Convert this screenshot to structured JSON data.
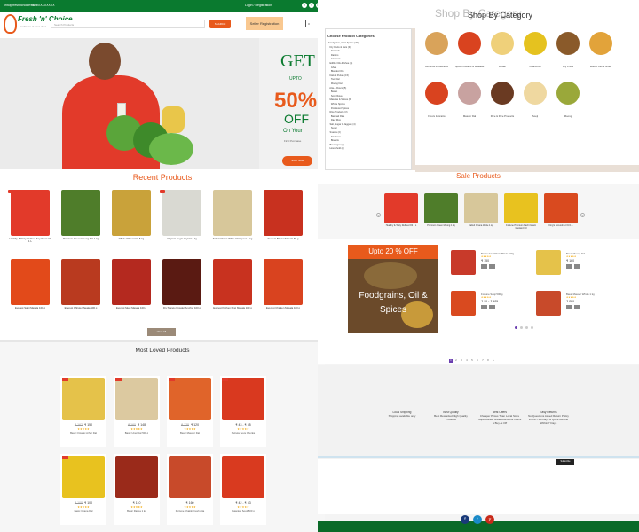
{
  "topbar": {
    "email": "info@freshnchoice.com",
    "phone": "+91 9XXXXXXXX",
    "social": [
      "f",
      "t",
      "in"
    ]
  },
  "header": {
    "brand": "Fresh 'n' Choice",
    "tagline": "freshness at your door",
    "search_placeholder": "Search Products",
    "search_button": "SEARCH",
    "login": "Login / Registration",
    "seller": "Seller Registration",
    "cart_count": "0"
  },
  "hero": {
    "get": "GET",
    "upto": "UPTO",
    "pct": "50%",
    "off": "OFF",
    "on": "On Your",
    "first": "First Purchase",
    "cta": "Shop Now"
  },
  "recent": {
    "title": "Recent Products",
    "view_all": "View All",
    "items": [
      {
        "name": "Healthy & Tasty Refined Soyabean Oil 1 L",
        "color": "#e23a2a",
        "sale": true
      },
      {
        "name": "Premium Green Moong Dal 1 kg",
        "color": "#4f7d2a",
        "sale": false
      },
      {
        "name": "Whole Wheat Atta 5 kg",
        "color": "#c9a23a",
        "sale": false
      },
      {
        "name": "Organic Sugar Crystal 1 kg",
        "color": "#d9d9d2",
        "sale": true
      },
      {
        "name": "Kabuli Chana White Chickpeas 1 kg",
        "color": "#d7c79a",
        "sale": false
      },
      {
        "name": "Everest Biryani Masala 50 g",
        "color": "#c8311f",
        "sale": false
      },
      {
        "name": "Everest Sabji Masala 100 g",
        "color": "#e24a1a",
        "sale": false
      },
      {
        "name": "Everest Chhole Masala 100 g",
        "color": "#b93a1f",
        "sale": false
      },
      {
        "name": "Everest Meat Masala 100 g",
        "color": "#b4291f",
        "sale": false
      },
      {
        "name": "Dry Mango Powder Amchur 100 g",
        "color": "#5a1a12",
        "sale": false
      },
      {
        "name": "Everest Kitchen King Masala 100 g",
        "color": "#c8321f",
        "sale": false
      },
      {
        "name": "Everest Chicken Masala 100 g",
        "color": "#d9431f",
        "sale": false
      }
    ]
  },
  "loved": {
    "title": "Most Loved Products",
    "items": [
      {
        "name": "Basic Organic Arhar Dal",
        "price": "₹ 150",
        "old": "₹ 162",
        "color": "#e5c24a",
        "sale": true
      },
      {
        "name": "Basic Urad Dal 500 g",
        "price": "₹ 148",
        "old": "₹ 160",
        "color": "#dcc9a0",
        "sale": true
      },
      {
        "name": "Basic Masoor Dal",
        "price": "₹ 120",
        "old": "₹ 128",
        "color": "#e0642a",
        "sale": true
      },
      {
        "name": "Nutrela Soya Chunks",
        "price": "₹ 43 - ₹ 55",
        "old": "",
        "color": "#d9391f",
        "sale": true
      },
      {
        "name": "Basic Chana Dal",
        "price": "₹ 100",
        "old": "₹ 108",
        "color": "#e8c21f",
        "sale": true
      },
      {
        "name": "Basic Rajma 1 kg",
        "price": "₹ 110",
        "old": "",
        "color": "#9a2a1a",
        "sale": false
      },
      {
        "name": "Fortune Chakki Fresh Atta",
        "price": "₹ 160",
        "old": "",
        "color": "#c84a2a",
        "sale": false
      },
      {
        "name": "Patanjali Sooji 500 g",
        "price": "₹ 42 - ₹ 53",
        "old": "",
        "color": "#d93a1f",
        "sale": false
      }
    ]
  },
  "categories": {
    "title": "Shop By Category",
    "panel_title": "Choose Product Categories",
    "list": "Foodgrains, Oil & Spices (40)\n  Dry Fruits & Nuts (3)\n    Almonds\n    Raisins\n    Cashews\n  Edible Oils & Ghee (5)\n    Ghee\n    Blended Oils\n  Dals & Pulses (15)\n    Toor Dal\n    Moong Dal\n  Atta & Flours (5)\n    Besan\n    Sooji Rava\n  Masalas & Spices (6)\n    Whole Spices\n    Powdered Spices\n  Rice Products (3)\n    Basmati Rice\n    Raw Rice\n  Salt, Sugar & Jaggery (4)\n    Sugar\n  Snacks (2)\n    Namkeen\n    Biscuits\n  Beverages (4)\n  Household (2)",
    "items": [
      {
        "name": "Almonds & Cashews",
        "color": "#d9a35a"
      },
      {
        "name": "Spice Powders & Masalas",
        "color": "#d9431f"
      },
      {
        "name": "Besan",
        "color": "#efd07a"
      },
      {
        "name": "Chana Dal",
        "color": "#e5c21f"
      },
      {
        "name": "Dry Fruits",
        "color": "#8a5a2a"
      },
      {
        "name": "Edible Oils & Ghee",
        "color": "#e2a33a"
      },
      {
        "name": "Flours & Grains",
        "color": "#d9431f"
      },
      {
        "name": "Masoor Dal",
        "color": "#c8a2a0"
      },
      {
        "name": "Rice & Rice Products",
        "color": "#6a3a22"
      },
      {
        "name": "Sooji",
        "color": "#efd8a0"
      },
      {
        "name": "Moong",
        "color": "#9aa83a"
      }
    ]
  },
  "sale": {
    "title": "Sale Products",
    "strip": [
      {
        "name": "Healthy & Tasty Refined Oil 1 L",
        "color": "#e23a2a"
      },
      {
        "name": "Premium Green Moong 1 kg",
        "color": "#4f7d2a"
      },
      {
        "name": "Kabuli Chana White 1 kg",
        "color": "#d7c79a"
      },
      {
        "name": "Fortune Premium Kachi Ghani Mustard Oil",
        "color": "#e8c21f"
      },
      {
        "name": "King's Groundnut Oil 1 L",
        "color": "#d94a1f"
      }
    ],
    "banner_top": "Upto 20 % OFF",
    "banner_text": "Foodgrains, Oil & Spices",
    "list": [
      {
        "name": "Basic Urad Whole Black 500g",
        "price": "₹ 150",
        "color": "#c83a2a"
      },
      {
        "name": "Basic Moong Dal",
        "price": "₹ 160",
        "color": "#e5c24a"
      },
      {
        "name": "Fortune Sooji 500 g",
        "price": "₹ 90 - ₹ 125",
        "color": "#d94a1f"
      },
      {
        "name": "Basic Masoor Whole 1 kg",
        "price": "₹ 280",
        "color": "#c84a2a"
      }
    ],
    "pages": [
      "1",
      "2",
      "3",
      "4",
      "5",
      "6",
      "7",
      "8",
      "»"
    ]
  },
  "features": [
    {
      "title": "Local Shipping",
      "text": "Shipping available only"
    },
    {
      "title": "Best Quality",
      "text": "Best Rewarded High Quality Products"
    },
    {
      "title": "Best Offers",
      "text": "Cheaper Prices Than Local Store Supermarket Great Discounts Offers & Buy At Off"
    },
    {
      "title": "Easy Returns",
      "text": "No Questions Asked Return Policy Within Two Days & Quick Refund Within 7 Days"
    }
  ],
  "footer": {
    "subscribe": "Subscribe",
    "social": [
      "f",
      "t",
      "y"
    ]
  },
  "colors": {
    "brand_green": "#0a7a2f",
    "accent_orange": "#e85a1c"
  }
}
